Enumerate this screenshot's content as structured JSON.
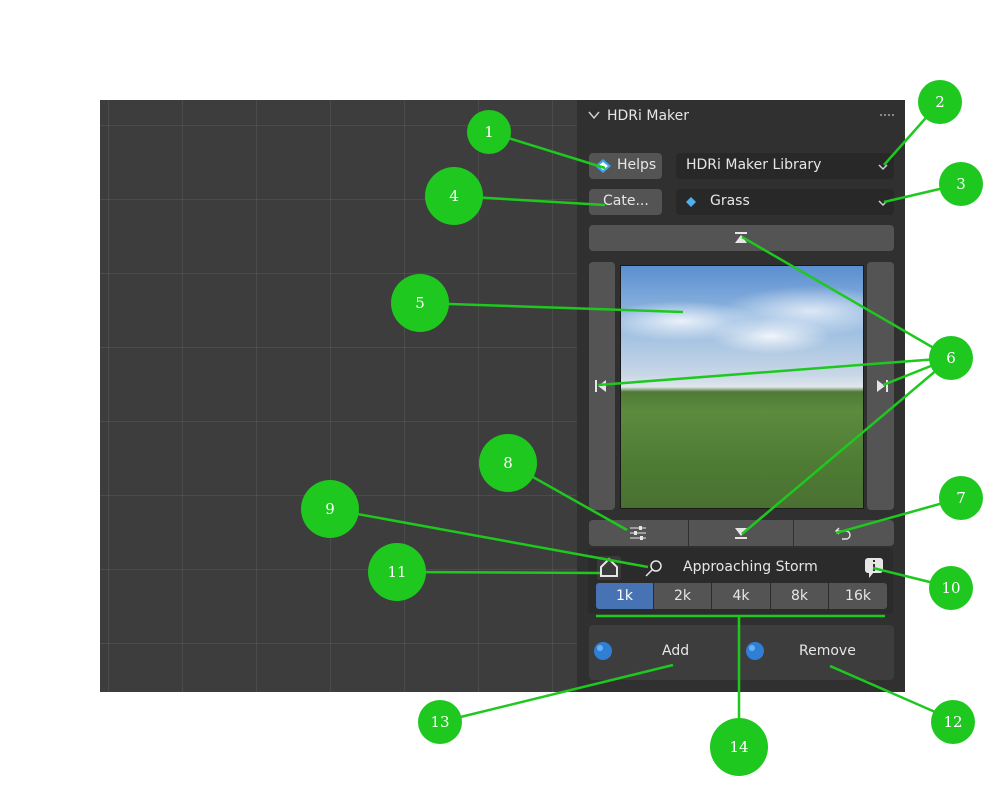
{
  "panel": {
    "title": "HDRi Maker",
    "helps_label": "Helps",
    "library_value": "HDRi Maker Library",
    "category_label": "Cate...",
    "category_value": "Grass",
    "asset_name": "Approaching Storm",
    "resolutions": [
      "1k",
      "2k",
      "4k",
      "8k",
      "16k"
    ],
    "selected_resolution": "1k",
    "add_label": "Add",
    "remove_label": "Remove"
  },
  "callouts": [
    "1",
    "2",
    "3",
    "4",
    "5",
    "6",
    "7",
    "8",
    "9",
    "10",
    "11",
    "12",
    "13",
    "14"
  ],
  "colors": {
    "callout": "#1ec81e",
    "accent": "#4772b3",
    "panel_bg": "#303030",
    "viewport_bg": "#3d3d3d"
  }
}
